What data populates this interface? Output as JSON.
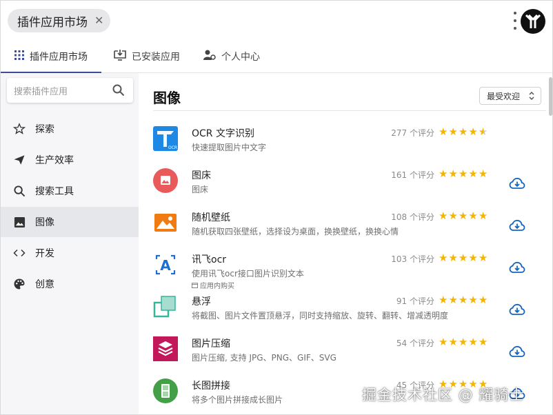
{
  "header": {
    "chip_label": "插件应用市场",
    "chip_close": "✕"
  },
  "tabs": [
    {
      "label": "插件应用市场",
      "icon": "grid-icon",
      "active": true
    },
    {
      "label": "已安装应用",
      "icon": "install-icon",
      "active": false
    },
    {
      "label": "个人中心",
      "icon": "user-settings-icon",
      "active": false
    }
  ],
  "sidebar": {
    "search_placeholder": "搜索插件应用",
    "items": [
      {
        "label": "探索",
        "icon": "star-outline-icon",
        "active": false
      },
      {
        "label": "生产效率",
        "icon": "send-icon",
        "active": false
      },
      {
        "label": "搜索工具",
        "icon": "search-icon",
        "active": false
      },
      {
        "label": "图像",
        "icon": "image-icon",
        "active": true
      },
      {
        "label": "开发",
        "icon": "code-icon",
        "active": false
      },
      {
        "label": "创意",
        "icon": "palette-icon",
        "active": false
      }
    ]
  },
  "main": {
    "title": "图像",
    "sort_label": "最受欢迎",
    "apps": [
      {
        "name": "OCR 文字识别",
        "desc": "快速提取图片中文字",
        "rating_text": "277 个评分",
        "rating": 4.5,
        "installed": true,
        "tag": "",
        "icon": "ocr-app-icon",
        "color": "#1e88e5"
      },
      {
        "name": "图床",
        "desc": "图床",
        "rating_text": "161 个评分",
        "rating": 5,
        "installed": false,
        "tag": "",
        "icon": "image-host-app-icon",
        "color": "#e95a5a"
      },
      {
        "name": "随机壁纸",
        "desc": "随机获取四张壁纸，选择设为桌面，换换壁纸，换换心情",
        "rating_text": "108 个评分",
        "rating": 5,
        "installed": false,
        "tag": "",
        "icon": "wallpaper-app-icon",
        "color": "#f07b12"
      },
      {
        "name": "讯飞ocr",
        "desc": "使用讯飞ocr接口图片识别文本",
        "rating_text": "103 个评分",
        "rating": 5,
        "installed": false,
        "tag": "应用内购买",
        "icon": "xunfei-ocr-app-icon",
        "color": "#1e6fd0"
      },
      {
        "name": "悬浮",
        "desc": "将截图、图片文件置顶悬浮，同时支持缩放、旋转、翻转、增减透明度",
        "rating_text": "91 个评分",
        "rating": 5,
        "installed": false,
        "tag": "",
        "icon": "float-app-icon",
        "color": "#35b59a"
      },
      {
        "name": "图片压缩",
        "desc": "图片压缩, 支持 JPG、PNG、GIF、SVG",
        "rating_text": "54 个评分",
        "rating": 5,
        "installed": false,
        "tag": "",
        "icon": "compress-app-icon",
        "color": "#c2185b"
      },
      {
        "name": "长图拼接",
        "desc": "将多个图片拼接成长图片",
        "rating_text": "45 个评分",
        "rating": 5,
        "installed": false,
        "tag": "",
        "icon": "long-image-app-icon",
        "color": "#43a047"
      }
    ]
  },
  "watermark": "掘金技术社区 @ 耀骑士"
}
